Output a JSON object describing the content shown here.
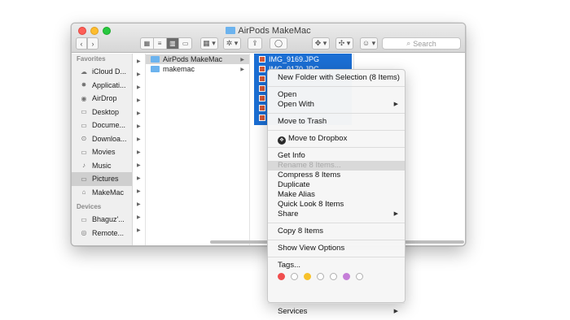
{
  "window": {
    "title": "AirPods MakeMac",
    "toolbar": {
      "back": "‹",
      "forward": "›",
      "view_icons": [
        "▦",
        "≡",
        "▥",
        "▭"
      ],
      "arrange": "▦ ▾",
      "action": "✲ ▾",
      "share": "⇪",
      "tag": "◯",
      "dropbox": "✥ ▾",
      "dropbox2": "✣ ▾",
      "user": "☺ ▾",
      "search_placeholder": "Search",
      "search_icon": "⌕"
    }
  },
  "sidebar": {
    "favorites_header": "Favorites",
    "devices_header": "Devices",
    "items": [
      {
        "label": "iCloud D...",
        "icon": "☁"
      },
      {
        "label": "Applicati...",
        "icon": "✸"
      },
      {
        "label": "AirDrop",
        "icon": "◉"
      },
      {
        "label": "Desktop",
        "icon": "▭"
      },
      {
        "label": "Docume...",
        "icon": "▭"
      },
      {
        "label": "Downloa...",
        "icon": "⊙"
      },
      {
        "label": "Movies",
        "icon": "▭"
      },
      {
        "label": "Music",
        "icon": "♪"
      },
      {
        "label": "Pictures",
        "icon": "▭"
      },
      {
        "label": "MakeMac",
        "icon": "⌂"
      }
    ],
    "devices": [
      {
        "label": "Bhaguz'...",
        "icon": "▭"
      },
      {
        "label": "Remote...",
        "icon": "◎"
      }
    ]
  },
  "columns": {
    "col1": [
      {
        "label": "AirPods MakeMac",
        "selected": true
      },
      {
        "label": "makemac",
        "selected": false
      }
    ],
    "col2": [
      {
        "label": "IMG_9169.JPG"
      },
      {
        "label": "IMG_9170.JPG"
      }
    ]
  },
  "context_menu": {
    "new_folder": "New Folder with Selection (8 Items)",
    "open": "Open",
    "open_with": "Open With",
    "move_trash": "Move to Trash",
    "move_dropbox": "Move to Dropbox",
    "get_info": "Get Info",
    "rename": "Rename 8 Items...",
    "compress": "Compress 8 Items",
    "duplicate": "Duplicate",
    "make_alias": "Make Alias",
    "quick_look": "Quick Look 8 Items",
    "share": "Share",
    "copy": "Copy 8 Items",
    "show_view_options": "Show View Options",
    "tags": "Tags...",
    "services": "Services",
    "submenu_arrow": "▶"
  },
  "tag_colors": [
    "#f04e4e",
    "#ffffff",
    "#f7c12a",
    "#ffffff",
    "#ffffff",
    "#c57ed8",
    "#ffffff"
  ],
  "colors": {
    "selection_blue": "#1b6ed3",
    "folder_blue": "#6cb3ee"
  }
}
